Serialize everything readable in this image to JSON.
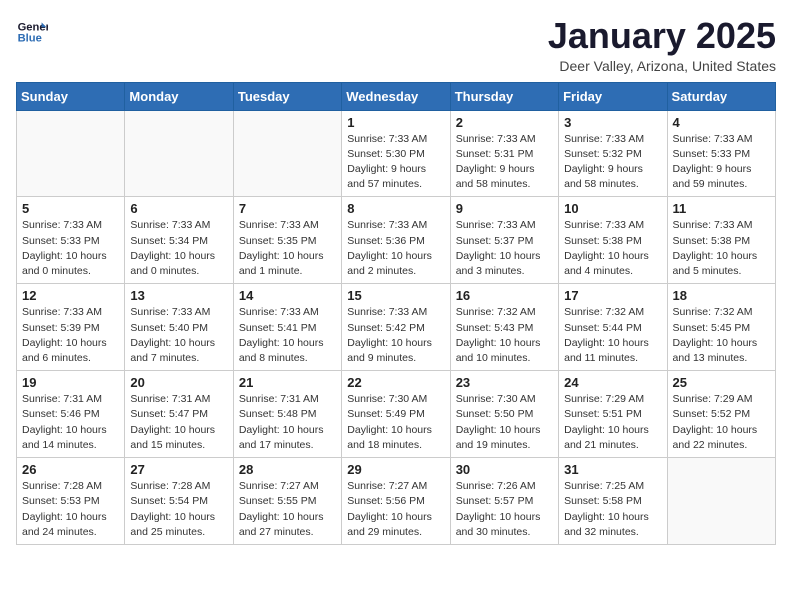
{
  "logo": {
    "line1": "General",
    "line2": "Blue"
  },
  "title": "January 2025",
  "subtitle": "Deer Valley, Arizona, United States",
  "weekdays": [
    "Sunday",
    "Monday",
    "Tuesday",
    "Wednesday",
    "Thursday",
    "Friday",
    "Saturday"
  ],
  "weeks": [
    [
      {
        "day": "",
        "info": ""
      },
      {
        "day": "",
        "info": ""
      },
      {
        "day": "",
        "info": ""
      },
      {
        "day": "1",
        "info": "Sunrise: 7:33 AM\nSunset: 5:30 PM\nDaylight: 9 hours\nand 57 minutes."
      },
      {
        "day": "2",
        "info": "Sunrise: 7:33 AM\nSunset: 5:31 PM\nDaylight: 9 hours\nand 58 minutes."
      },
      {
        "day": "3",
        "info": "Sunrise: 7:33 AM\nSunset: 5:32 PM\nDaylight: 9 hours\nand 58 minutes."
      },
      {
        "day": "4",
        "info": "Sunrise: 7:33 AM\nSunset: 5:33 PM\nDaylight: 9 hours\nand 59 minutes."
      }
    ],
    [
      {
        "day": "5",
        "info": "Sunrise: 7:33 AM\nSunset: 5:33 PM\nDaylight: 10 hours\nand 0 minutes."
      },
      {
        "day": "6",
        "info": "Sunrise: 7:33 AM\nSunset: 5:34 PM\nDaylight: 10 hours\nand 0 minutes."
      },
      {
        "day": "7",
        "info": "Sunrise: 7:33 AM\nSunset: 5:35 PM\nDaylight: 10 hours\nand 1 minute."
      },
      {
        "day": "8",
        "info": "Sunrise: 7:33 AM\nSunset: 5:36 PM\nDaylight: 10 hours\nand 2 minutes."
      },
      {
        "day": "9",
        "info": "Sunrise: 7:33 AM\nSunset: 5:37 PM\nDaylight: 10 hours\nand 3 minutes."
      },
      {
        "day": "10",
        "info": "Sunrise: 7:33 AM\nSunset: 5:38 PM\nDaylight: 10 hours\nand 4 minutes."
      },
      {
        "day": "11",
        "info": "Sunrise: 7:33 AM\nSunset: 5:38 PM\nDaylight: 10 hours\nand 5 minutes."
      }
    ],
    [
      {
        "day": "12",
        "info": "Sunrise: 7:33 AM\nSunset: 5:39 PM\nDaylight: 10 hours\nand 6 minutes."
      },
      {
        "day": "13",
        "info": "Sunrise: 7:33 AM\nSunset: 5:40 PM\nDaylight: 10 hours\nand 7 minutes."
      },
      {
        "day": "14",
        "info": "Sunrise: 7:33 AM\nSunset: 5:41 PM\nDaylight: 10 hours\nand 8 minutes."
      },
      {
        "day": "15",
        "info": "Sunrise: 7:33 AM\nSunset: 5:42 PM\nDaylight: 10 hours\nand 9 minutes."
      },
      {
        "day": "16",
        "info": "Sunrise: 7:32 AM\nSunset: 5:43 PM\nDaylight: 10 hours\nand 10 minutes."
      },
      {
        "day": "17",
        "info": "Sunrise: 7:32 AM\nSunset: 5:44 PM\nDaylight: 10 hours\nand 11 minutes."
      },
      {
        "day": "18",
        "info": "Sunrise: 7:32 AM\nSunset: 5:45 PM\nDaylight: 10 hours\nand 13 minutes."
      }
    ],
    [
      {
        "day": "19",
        "info": "Sunrise: 7:31 AM\nSunset: 5:46 PM\nDaylight: 10 hours\nand 14 minutes."
      },
      {
        "day": "20",
        "info": "Sunrise: 7:31 AM\nSunset: 5:47 PM\nDaylight: 10 hours\nand 15 minutes."
      },
      {
        "day": "21",
        "info": "Sunrise: 7:31 AM\nSunset: 5:48 PM\nDaylight: 10 hours\nand 17 minutes."
      },
      {
        "day": "22",
        "info": "Sunrise: 7:30 AM\nSunset: 5:49 PM\nDaylight: 10 hours\nand 18 minutes."
      },
      {
        "day": "23",
        "info": "Sunrise: 7:30 AM\nSunset: 5:50 PM\nDaylight: 10 hours\nand 19 minutes."
      },
      {
        "day": "24",
        "info": "Sunrise: 7:29 AM\nSunset: 5:51 PM\nDaylight: 10 hours\nand 21 minutes."
      },
      {
        "day": "25",
        "info": "Sunrise: 7:29 AM\nSunset: 5:52 PM\nDaylight: 10 hours\nand 22 minutes."
      }
    ],
    [
      {
        "day": "26",
        "info": "Sunrise: 7:28 AM\nSunset: 5:53 PM\nDaylight: 10 hours\nand 24 minutes."
      },
      {
        "day": "27",
        "info": "Sunrise: 7:28 AM\nSunset: 5:54 PM\nDaylight: 10 hours\nand 25 minutes."
      },
      {
        "day": "28",
        "info": "Sunrise: 7:27 AM\nSunset: 5:55 PM\nDaylight: 10 hours\nand 27 minutes."
      },
      {
        "day": "29",
        "info": "Sunrise: 7:27 AM\nSunset: 5:56 PM\nDaylight: 10 hours\nand 29 minutes."
      },
      {
        "day": "30",
        "info": "Sunrise: 7:26 AM\nSunset: 5:57 PM\nDaylight: 10 hours\nand 30 minutes."
      },
      {
        "day": "31",
        "info": "Sunrise: 7:25 AM\nSunset: 5:58 PM\nDaylight: 10 hours\nand 32 minutes."
      },
      {
        "day": "",
        "info": ""
      }
    ]
  ]
}
